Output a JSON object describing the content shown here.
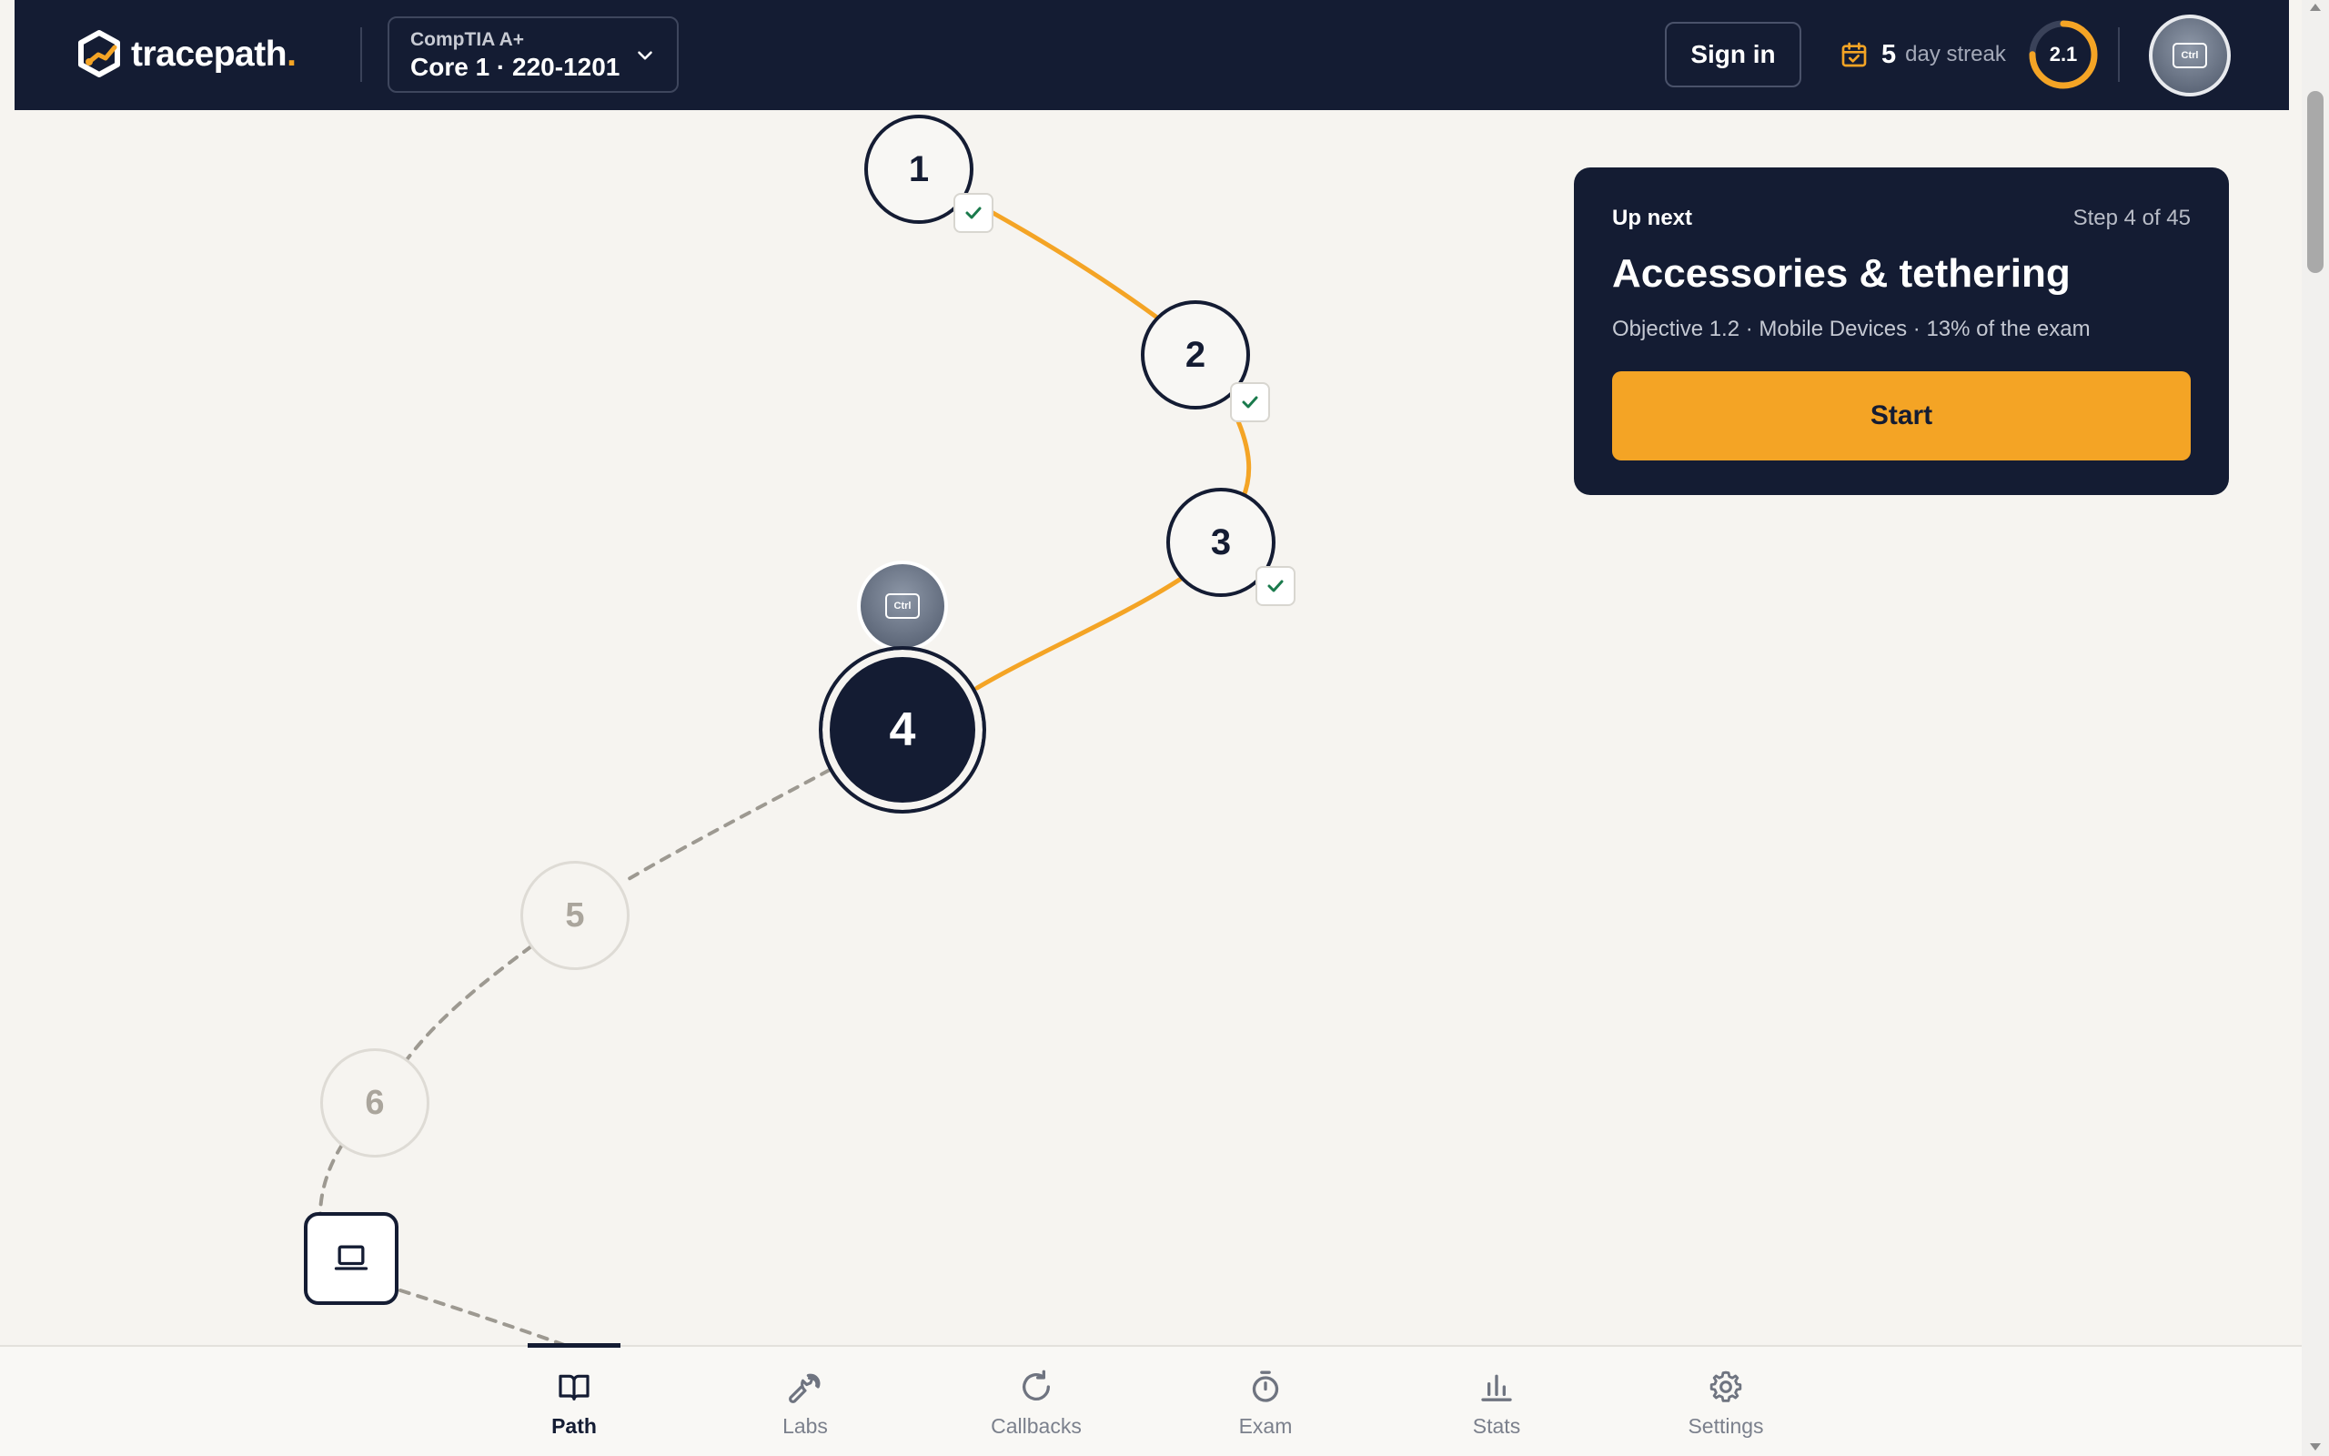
{
  "header": {
    "brand": "tracepath",
    "brand_dot": ".",
    "course": {
      "cert": "CompTIA A+",
      "name": "Core 1 · 220-1201"
    },
    "sign_in": "Sign in",
    "streak": {
      "count": "5",
      "label": "day streak"
    },
    "level": {
      "value": "2.1",
      "progress": 0.75
    },
    "avatar_key": "Ctrl"
  },
  "path": {
    "nodes": [
      {
        "number": "1",
        "state": "done"
      },
      {
        "number": "2",
        "state": "done"
      },
      {
        "number": "3",
        "state": "done"
      },
      {
        "number": "4",
        "state": "current"
      },
      {
        "number": "5",
        "state": "locked"
      },
      {
        "number": "6",
        "state": "locked"
      }
    ],
    "lab_node_icon": "laptop-icon",
    "avatar_key": "Ctrl"
  },
  "up_next": {
    "label": "Up next",
    "step": "Step 4 of 45",
    "title": "Accessories & tethering",
    "meta": "Objective 1.2 · Mobile Devices · 13% of the exam",
    "button": "Start"
  },
  "bottom_nav": {
    "items": [
      {
        "label": "Path",
        "icon": "book-icon",
        "active": true
      },
      {
        "label": "Labs",
        "icon": "wrench-icon",
        "active": false
      },
      {
        "label": "Callbacks",
        "icon": "refresh-icon",
        "active": false
      },
      {
        "label": "Exam",
        "icon": "stopwatch-icon",
        "active": false
      },
      {
        "label": "Stats",
        "icon": "bar-chart-icon",
        "active": false
      },
      {
        "label": "Settings",
        "icon": "gear-icon",
        "active": false
      }
    ]
  },
  "colors": {
    "navy": "#141c33",
    "accent": "#f4a425",
    "background": "#f6f4f0",
    "check": "#1a7a4c"
  }
}
